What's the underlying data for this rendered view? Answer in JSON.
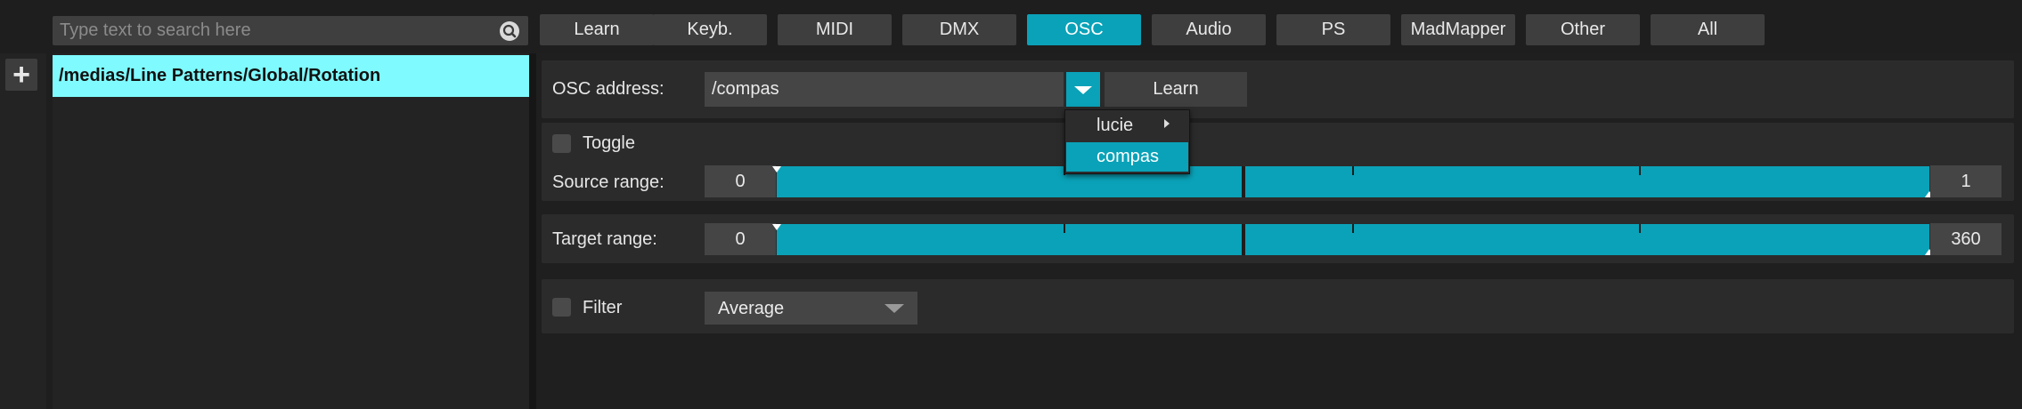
{
  "search": {
    "placeholder": "Type text to search here"
  },
  "tabs": [
    {
      "label": "Learn",
      "active": false
    },
    {
      "label": "Keyb.",
      "active": false
    },
    {
      "label": "MIDI",
      "active": false
    },
    {
      "label": "DMX",
      "active": false
    },
    {
      "label": "OSC",
      "active": true
    },
    {
      "label": "Audio",
      "active": false
    },
    {
      "label": "PS",
      "active": false
    },
    {
      "label": "MadMapper",
      "active": false
    },
    {
      "label": "Other",
      "active": false
    },
    {
      "label": "All",
      "active": false
    }
  ],
  "sidebar": {
    "add_label": "+",
    "selected_item": "/medias/Line Patterns/Global/Rotation"
  },
  "osc": {
    "address_label": "OSC address:",
    "address_value": "/compas",
    "learn_label": "Learn",
    "menu_items": [
      "lucie",
      "compas"
    ],
    "menu_selected": "compas"
  },
  "toggle": {
    "label": "Toggle",
    "checked": false
  },
  "source_range": {
    "label": "Source range:",
    "min": "0",
    "max": "1",
    "fill_fraction": 1.0
  },
  "target_range": {
    "label": "Target range:",
    "min": "0",
    "max": "360",
    "fill_fraction": 1.0
  },
  "filter": {
    "label": "Filter",
    "checked": false,
    "value": "Average"
  },
  "colors": {
    "accent": "#0aa2b8",
    "selection": "#7ffbff",
    "background": "#1e1e1e"
  }
}
